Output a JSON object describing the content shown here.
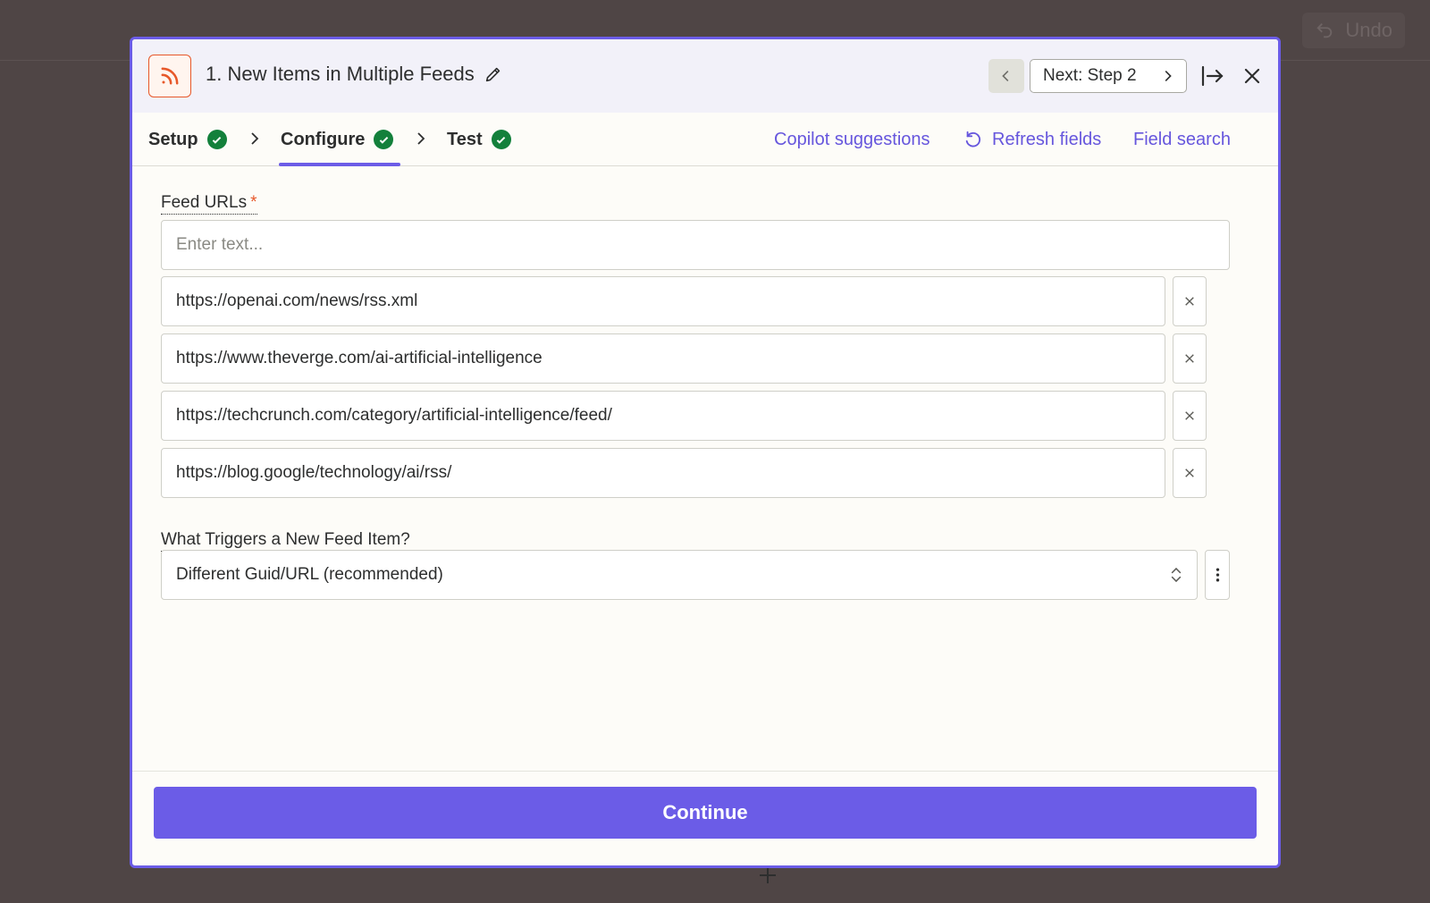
{
  "background": {
    "undo_label": "Undo"
  },
  "modal": {
    "header": {
      "title": "1. New Items in Multiple Feeds",
      "next_label": "Next: Step 2",
      "app_icon": "rss-icon"
    },
    "tabs": [
      {
        "label": "Setup",
        "complete": true
      },
      {
        "label": "Configure",
        "complete": true,
        "active": true
      },
      {
        "label": "Test",
        "complete": true
      }
    ],
    "actions": {
      "copilot": "Copilot suggestions",
      "refresh": "Refresh fields",
      "search": "Field search"
    },
    "feed_urls": {
      "label": "Feed URLs",
      "required_mark": "*",
      "placeholder": "Enter text...",
      "items": [
        "https://openai.com/news/rss.xml",
        "https://www.theverge.com/ai-artificial-intelligence",
        "https://techcrunch.com/category/artificial-intelligence/feed/",
        "https://blog.google/technology/ai/rss/"
      ]
    },
    "trigger": {
      "label": "What Triggers a New Feed Item?",
      "selected": "Different Guid/URL (recommended)"
    },
    "footer": {
      "continue_label": "Continue"
    }
  },
  "colors": {
    "accent": "#6b5ce7",
    "check": "#13803b",
    "rss": "#e7582a",
    "link": "#6656dd"
  }
}
